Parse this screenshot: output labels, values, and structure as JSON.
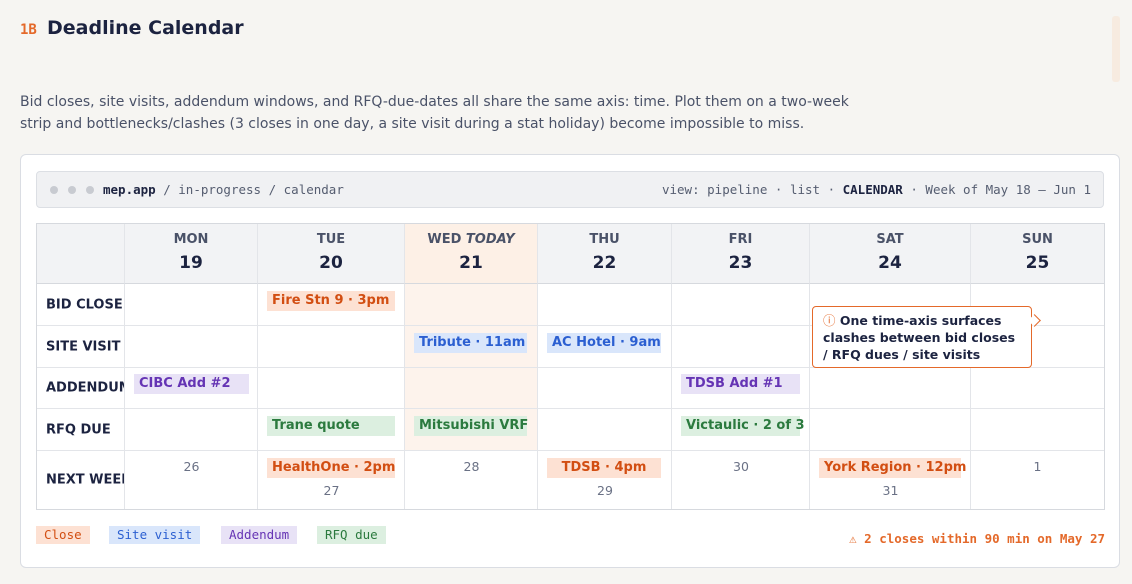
{
  "section": {
    "tag": "1B",
    "title": "Deadline Calendar",
    "description": "Bid closes, site visits, addendum windows, and RFQ-due-dates all share the same axis: time. Plot them on a two-week strip and bottlenecks/clashes (3 closes in one day, a site visit during a stat holiday) become impossible to miss."
  },
  "browser": {
    "host": "mep.app",
    "path_sep": " / ",
    "path1": "in-progress",
    "path2": "calendar",
    "view_prefix": "view: ",
    "view_pipeline": "pipeline",
    "sep": " · ",
    "view_list": "list",
    "view_calendar": "CALENDAR",
    "week_label": "Week of May 18 — Jun 1"
  },
  "calendar": {
    "days": [
      {
        "name": "MON",
        "num": "19"
      },
      {
        "name": "TUE",
        "num": "20"
      },
      {
        "name": "WED",
        "today_label": "TODAY",
        "num": "21"
      },
      {
        "name": "THU",
        "num": "22"
      },
      {
        "name": "FRI",
        "num": "23"
      },
      {
        "name": "SAT",
        "num": "24"
      },
      {
        "name": "SUN",
        "num": "25"
      }
    ],
    "rows": [
      "BID CLOSE",
      "SITE VISIT",
      "ADDENDUM",
      "RFQ DUE",
      "NEXT WEEK"
    ],
    "events": {
      "bid_tue": "Fire Stn 9 · 3pm",
      "site_wed": "Tribute · 11am",
      "site_thu": "AC Hotel · 9am",
      "add_mon": "CIBC Add #2",
      "add_fri": "TDSB Add #1",
      "rfq_tue": "Trane quote",
      "rfq_wed": "Mitsubishi VRF",
      "rfq_fri": "Victaulic · 2 of 3"
    },
    "next_week": {
      "mon_date": "26",
      "tue_event": "HealthOne · 2pm",
      "tue_date": "27",
      "wed_date": "28",
      "thu_event": "TDSB · 4pm",
      "thu_date": "29",
      "fri_date": "30",
      "sat_event": "York Region · 12pm",
      "sat_date": "31",
      "sun_date": "1"
    }
  },
  "callout": {
    "icon": "ⓘ",
    "text": "One time-axis surfaces clashes between bid closes / RFQ dues / site visits"
  },
  "legend": {
    "close": "Close",
    "site": "Site visit",
    "addendum": "Addendum",
    "rfq": "RFQ due"
  },
  "clash_note": "⚠ 2 closes within 90 min on May 27",
  "colors": {
    "accent": "#e4692a",
    "close": "#d24e12",
    "site_visit": "#2b5fd1",
    "addendum": "#6534b4",
    "rfq_due": "#2b7a3e"
  }
}
